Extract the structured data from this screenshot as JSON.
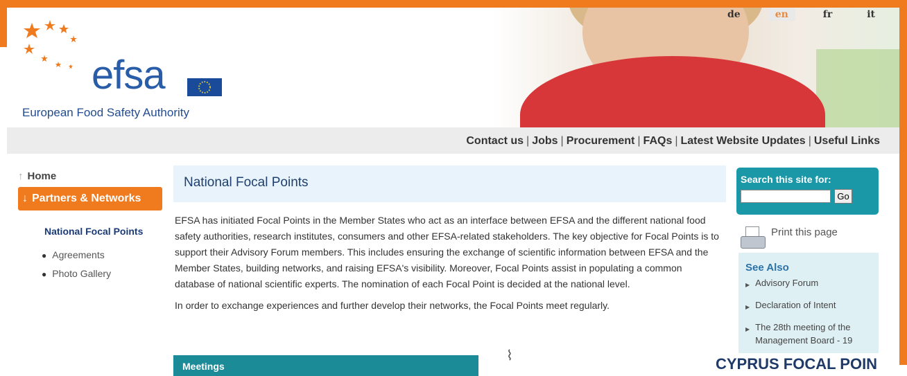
{
  "brand": {
    "name": "efsa",
    "subtitle": "European Food Safety Authority"
  },
  "languages": [
    {
      "code": "de",
      "active": false
    },
    {
      "code": "en",
      "active": true
    },
    {
      "code": "fr",
      "active": false
    },
    {
      "code": "it",
      "active": false
    }
  ],
  "topnav": [
    "Contact us",
    "Jobs",
    "Procurement",
    "FAQs",
    "Latest Website Updates",
    "Useful Links"
  ],
  "leftnav": {
    "home": "Home",
    "section": "Partners & Networks",
    "current": "National Focal Points",
    "subitems": [
      "Agreements",
      "Photo Gallery"
    ]
  },
  "content": {
    "title": "National Focal Points",
    "paragraph1": "EFSA has initiated Focal Points in the Member States who act as an interface between EFSA and the different national food safety authorities, research institutes, consumers and other EFSA-related stakeholders. The key objective for Focal Points is to support their Advisory Forum members. This includes ensuring the exchange of scientific information between EFSA and the Member States, building networks, and raising EFSA's visibility. Moreover, Focal Points assist in populating a common database of national scientific experts. The nomination of each Focal Point is decided at the national level.",
    "paragraph2": "In order to exchange experiences and further develop their networks, the Focal Points meet regularly.",
    "meetings_heading": "Meetings",
    "banner_text": "CYPRUS FOCAL POIN"
  },
  "sidebar": {
    "search_label": "Search this site for:",
    "search_value": "",
    "go_label": "Go",
    "print_label": "Print this page",
    "see_also_title": "See Also",
    "see_also": [
      "Advisory Forum",
      "Declaration of Intent",
      "The 28th meeting of the Management Board - 19"
    ]
  },
  "colors": {
    "accent_orange": "#f07a1e",
    "teal": "#1a98a8",
    "brand_blue": "#2a5da8"
  }
}
